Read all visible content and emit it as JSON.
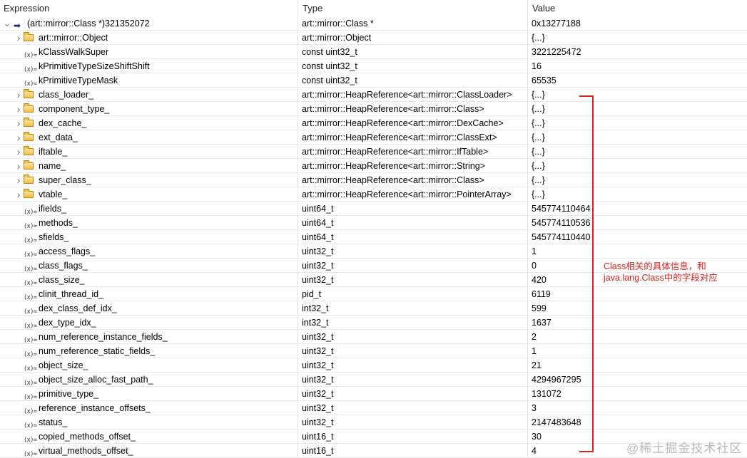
{
  "columns": {
    "expression": "Expression",
    "type": "Type",
    "value": "Value"
  },
  "rows": [
    {
      "name": "(art::mirror::Class *)321352072",
      "type": "art::mirror::Class *",
      "value": "0x13277188",
      "icon": "arrow-icon",
      "expand": "expanded",
      "depth": 0
    },
    {
      "name": "art::mirror::Object",
      "type": "art::mirror::Object",
      "value": "{...}",
      "icon": "folder-icon",
      "expand": "collapsed",
      "depth": 1
    },
    {
      "name": "kClassWalkSuper",
      "type": "const uint32_t",
      "value": "3221225472",
      "icon": "variable-icon",
      "expand": "none",
      "depth": 1
    },
    {
      "name": "kPrimitiveTypeSizeShiftShift",
      "type": "const uint32_t",
      "value": "16",
      "icon": "variable-icon",
      "expand": "none",
      "depth": 1
    },
    {
      "name": "kPrimitiveTypeMask",
      "type": "const uint32_t",
      "value": "65535",
      "icon": "variable-icon",
      "expand": "none",
      "depth": 1
    },
    {
      "name": "class_loader_",
      "type": "art::mirror::HeapReference<art::mirror::ClassLoader>",
      "value": "{...}",
      "icon": "folder-icon",
      "expand": "collapsed",
      "depth": 1
    },
    {
      "name": "component_type_",
      "type": "art::mirror::HeapReference<art::mirror::Class>",
      "value": "{...}",
      "icon": "folder-icon",
      "expand": "collapsed",
      "depth": 1
    },
    {
      "name": "dex_cache_",
      "type": "art::mirror::HeapReference<art::mirror::DexCache>",
      "value": "{...}",
      "icon": "folder-icon",
      "expand": "collapsed",
      "depth": 1
    },
    {
      "name": "ext_data_",
      "type": "art::mirror::HeapReference<art::mirror::ClassExt>",
      "value": "{...}",
      "icon": "folder-icon",
      "expand": "collapsed",
      "depth": 1
    },
    {
      "name": "iftable_",
      "type": "art::mirror::HeapReference<art::mirror::IfTable>",
      "value": "{...}",
      "icon": "folder-icon",
      "expand": "collapsed",
      "depth": 1
    },
    {
      "name": "name_",
      "type": "art::mirror::HeapReference<art::mirror::String>",
      "value": "{...}",
      "icon": "folder-icon",
      "expand": "collapsed",
      "depth": 1
    },
    {
      "name": "super_class_",
      "type": "art::mirror::HeapReference<art::mirror::Class>",
      "value": "{...}",
      "icon": "folder-icon",
      "expand": "collapsed",
      "depth": 1
    },
    {
      "name": "vtable_",
      "type": "art::mirror::HeapReference<art::mirror::PointerArray>",
      "value": "{...}",
      "icon": "folder-icon",
      "expand": "collapsed",
      "depth": 1
    },
    {
      "name": "ifields_",
      "type": "uint64_t",
      "value": "545774110464",
      "icon": "variable-icon",
      "expand": "none",
      "depth": 1
    },
    {
      "name": "methods_",
      "type": "uint64_t",
      "value": "545774110536",
      "icon": "variable-icon",
      "expand": "none",
      "depth": 1
    },
    {
      "name": "sfields_",
      "type": "uint64_t",
      "value": "545774110440",
      "icon": "variable-icon",
      "expand": "none",
      "depth": 1
    },
    {
      "name": "access_flags_",
      "type": "uint32_t",
      "value": "1",
      "icon": "variable-icon",
      "expand": "none",
      "depth": 1
    },
    {
      "name": "class_flags_",
      "type": "uint32_t",
      "value": "0",
      "icon": "variable-icon",
      "expand": "none",
      "depth": 1
    },
    {
      "name": "class_size_",
      "type": "uint32_t",
      "value": "420",
      "icon": "variable-icon",
      "expand": "none",
      "depth": 1
    },
    {
      "name": "clinit_thread_id_",
      "type": "pid_t",
      "value": "6119",
      "icon": "variable-icon",
      "expand": "none",
      "depth": 1
    },
    {
      "name": "dex_class_def_idx_",
      "type": "int32_t",
      "value": "599",
      "icon": "variable-icon",
      "expand": "none",
      "depth": 1
    },
    {
      "name": "dex_type_idx_",
      "type": "int32_t",
      "value": "1637",
      "icon": "variable-icon",
      "expand": "none",
      "depth": 1
    },
    {
      "name": "num_reference_instance_fields_",
      "type": "uint32_t",
      "value": "2",
      "icon": "variable-icon",
      "expand": "none",
      "depth": 1
    },
    {
      "name": "num_reference_static_fields_",
      "type": "uint32_t",
      "value": "1",
      "icon": "variable-icon",
      "expand": "none",
      "depth": 1
    },
    {
      "name": "object_size_",
      "type": "uint32_t",
      "value": "21",
      "icon": "variable-icon",
      "expand": "none",
      "depth": 1
    },
    {
      "name": "object_size_alloc_fast_path_",
      "type": "uint32_t",
      "value": "4294967295",
      "icon": "variable-icon",
      "expand": "none",
      "depth": 1
    },
    {
      "name": "primitive_type_",
      "type": "uint32_t",
      "value": "131072",
      "icon": "variable-icon",
      "expand": "none",
      "depth": 1
    },
    {
      "name": "reference_instance_offsets_",
      "type": "uint32_t",
      "value": "3",
      "icon": "variable-icon",
      "expand": "none",
      "depth": 1
    },
    {
      "name": "status_",
      "type": "uint32_t",
      "value": "2147483648",
      "icon": "variable-icon",
      "expand": "none",
      "depth": 1
    },
    {
      "name": "copied_methods_offset_",
      "type": "uint16_t",
      "value": "30",
      "icon": "variable-icon",
      "expand": "none",
      "depth": 1
    },
    {
      "name": "virtual_methods_offset_",
      "type": "uint16_t",
      "value": "4",
      "icon": "variable-icon",
      "expand": "none",
      "depth": 1
    }
  ],
  "annotation": {
    "line1": "Class相关的具体信息，和",
    "line2": "java.lang.Class中的字段对应",
    "color": "#e0201c"
  },
  "watermark": "@稀土掘金技术社区",
  "icons": {
    "variable": "(x)=",
    "arrow": "➡"
  }
}
